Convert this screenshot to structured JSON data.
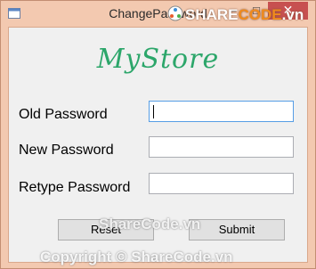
{
  "window": {
    "title": "ChangePassword",
    "minimize_glyph": "–",
    "maximize_glyph": "□",
    "close_glyph": "✕"
  },
  "brand": {
    "text": "MyStore",
    "color": "#2ca66a"
  },
  "form": {
    "old_password_label": "Old Password",
    "new_password_label": "New Password",
    "retype_password_label": "Retype Password",
    "old_password_value": "",
    "new_password_value": "",
    "retype_password_value": ""
  },
  "buttons": {
    "reset_label": "Reset",
    "submit_label": "Submit"
  },
  "watermarks": {
    "top_prefix": "SHARE",
    "top_accent": "CODE",
    "top_suffix": ".vn",
    "middle": "ShareCode.vn",
    "bottom": "Copyright © ShareCode.vn"
  },
  "colors": {
    "titlebar": "#f3c9b0",
    "close_button": "#c75050",
    "focus_border": "#569de5"
  }
}
